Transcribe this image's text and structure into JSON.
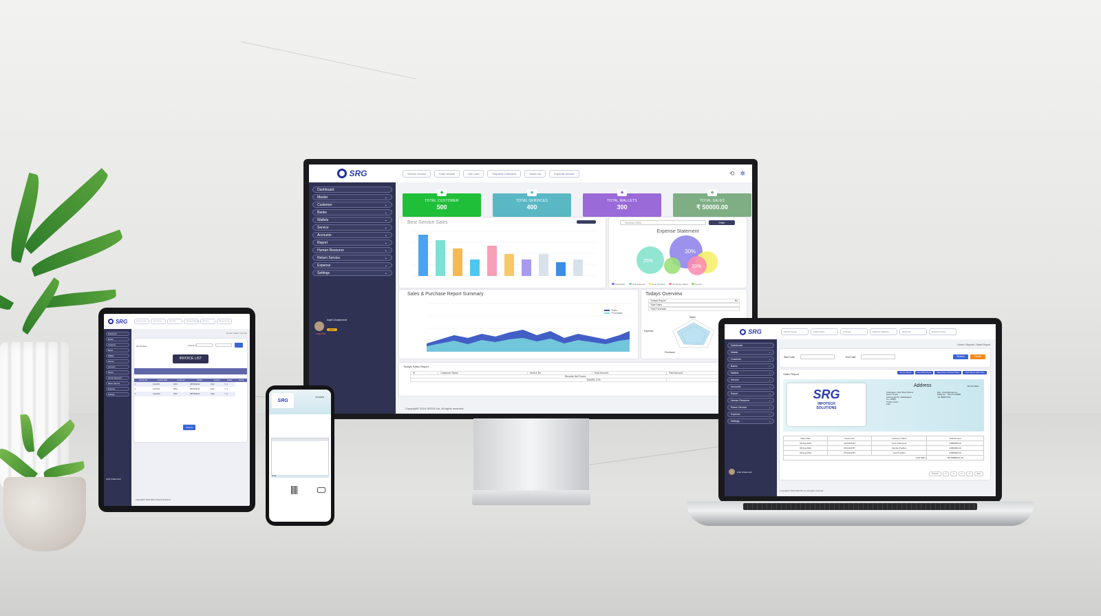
{
  "monitor": {
    "logo": "SRG",
    "topbar": [
      "Service Invoice",
      "Cash Invoice",
      "Job Card",
      "Payment Collection",
      "Stock List",
      "Expense Invoice"
    ],
    "nav": [
      "Dashboard",
      "Master",
      "Customer",
      "Banks",
      "Wallets",
      "Service",
      "Accounts",
      "Report",
      "Human Resource",
      "Return Service",
      "Expense",
      "Settings"
    ],
    "user": {
      "name": "Arpit Chaturvedi",
      "role": "Admin",
      "logout": "Log Out"
    },
    "stats": [
      {
        "label": "TOTAL CUSTOMER",
        "value": "500",
        "color": "#1fbf3a"
      },
      {
        "label": "TOTAL SERVICES",
        "value": "400",
        "color": "#5ab8c5"
      },
      {
        "label": "TOTAL WALLETS",
        "value": "300",
        "color": "#9a6ad8"
      },
      {
        "label": "TOTAL SALES",
        "value": "₹ 50000.00",
        "color": "#7fae85"
      }
    ],
    "best_service": {
      "title": "Best Service Sales"
    },
    "expense": {
      "title": "Expense Statement",
      "month": "October 2024",
      "button": "Filter",
      "legend": [
        "Total Sales",
        "Total Expense",
        "Total Purchase",
        "Employee Salary",
        "Service"
      ]
    },
    "sales_summary": {
      "title": "Sales & Purchase Report Summary",
      "legend": [
        "Sales",
        "Purchases"
      ]
    },
    "overview": {
      "title": "Todays Overview",
      "rows": [
        "Todays Report",
        "Total Sales",
        "Total Purchase"
      ],
      "col": "Rs",
      "radar_labels": [
        "Sales",
        "Expense",
        "Purchase",
        "Profit"
      ]
    },
    "todays_sales": {
      "title": "Todays Sales Report",
      "cols": [
        "Sl",
        "Customer Name",
        "Invoice No",
        "Total Amount",
        "Paid Amount"
      ],
      "empty": "Records Not Found",
      "total_label": "Total",
      "total_value": "Rs 0.00"
    },
    "footer": "Copyright© 2024 SRGIS Ltd. All rights reserved."
  },
  "tablet": {
    "title": "INVOICE LIST",
    "subtitle": "All Invoices",
    "breadcrumb": "Home / Sales / Invoice",
    "filter_label": "Invoice Id",
    "cols": [
      "Invoice No",
      "Invoice Date",
      "Customer",
      "Mobile",
      "Amount",
      "Status",
      "Action"
    ],
    "rows": [
      [
        "1",
        "CInv/101",
        "2024",
        "9876543210",
        "Paid"
      ],
      [
        "2",
        "CInv/102",
        "2024",
        "9876543211",
        "Paid"
      ],
      [
        "3",
        "CInv/103",
        "2024",
        "9876543212",
        "Paid"
      ]
    ],
    "button": "Search",
    "user": "Arpit Chaturvedi",
    "footer": "Copyright© 2024 SRG Infotech Solutions"
  },
  "phone": {
    "title": "Invoice",
    "total": "Total"
  },
  "laptop": {
    "breadcrumb": "Home / Reports / Sales Report",
    "start_label": "Start Date",
    "end_label": "End Date",
    "search_btn": "Search",
    "reset_btn": "Reset",
    "report_title": "Sales Report",
    "report_buttons": [
      "Service Report",
      "Price Wise Report",
      "Sales Report (Product Wise)",
      "Profit Report (Sale Wise)"
    ],
    "address_title": "Address",
    "address_date": "25-Oct-2024",
    "address_lines": [
      "Khalinagaon, Near Shree Dharma",
      "Sachin Temple",
      "Ankitmangal P.O, Delhibaagaon",
      "Pin: 135865",
      "Tinsuki, Assam",
      "India"
    ],
    "contact_lines": [
      "Mail - Infosrg@gmail.com",
      "Mobile No. - +91 7977162885",
      "+91 9898572323"
    ],
    "company": [
      "SRG",
      "INFOTECH",
      "SOLUTIONS"
    ],
    "table_cols": [
      "Sales Date",
      "Invoice No.",
      "Customer Name",
      "Total Amount"
    ],
    "table_rows": [
      [
        "08 Aug 2024",
        "INV/24/0787",
        "Amit Chaturvedi",
        "44899950.00"
      ],
      [
        "08 Aug 2024",
        "INV/24/0787",
        "Varsha Pradhan",
        "44899950.00"
      ],
      [
        "08 Aug 2024",
        "INV/24/0787",
        "Amit Pradhan",
        "44899950.00"
      ]
    ],
    "total_label": "Total Sales",
    "total_value": "86799885231.00",
    "pagination": [
      "Previous",
      "1",
      "2",
      "3",
      "4",
      "Next"
    ],
    "user": "Arpit Chaturvedi",
    "footer": "Copyright© 2024 SRGIS Ltd. All rights reserved."
  }
}
